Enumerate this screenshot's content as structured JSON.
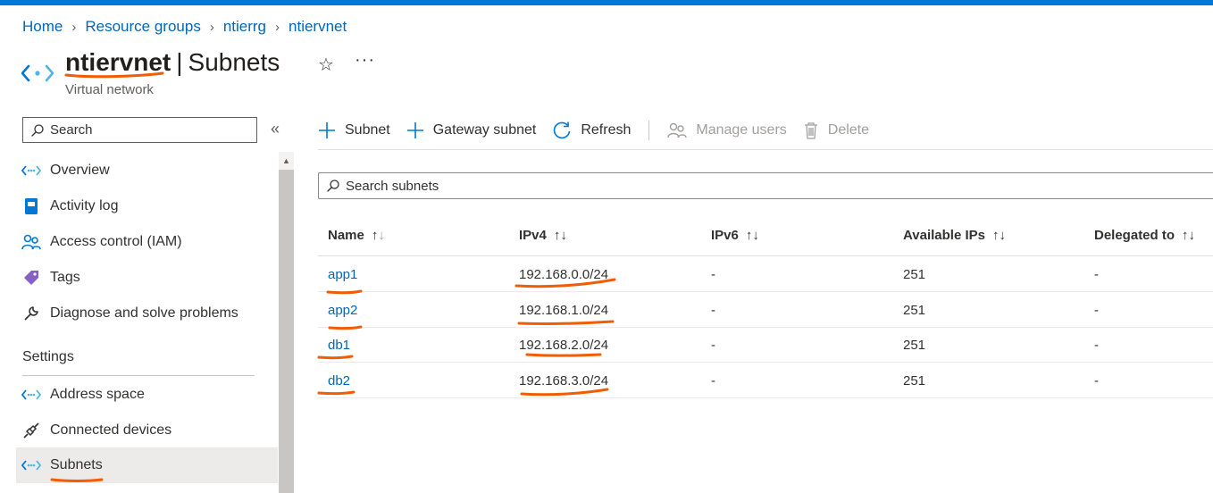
{
  "breadcrumb": [
    "Home",
    "Resource groups",
    "ntierrg",
    "ntiervnet"
  ],
  "header": {
    "resource_name": "ntiervnet",
    "separator": "|",
    "page_name": "Subnets",
    "subtitle": "Virtual network",
    "favorite_icon": "star-icon",
    "more_icon": "ellipsis-icon"
  },
  "sidebar": {
    "search_placeholder": "Search",
    "collapse_glyph": "«",
    "items": [
      {
        "label": "Overview",
        "icon": "vnet-icon"
      },
      {
        "label": "Activity log",
        "icon": "activity-log-icon"
      },
      {
        "label": "Access control (IAM)",
        "icon": "people-icon"
      },
      {
        "label": "Tags",
        "icon": "tag-icon"
      },
      {
        "label": "Diagnose and solve problems",
        "icon": "wrench-icon"
      }
    ],
    "settings_heading": "Settings",
    "settings_items": [
      {
        "label": "Address space",
        "icon": "vnet-icon"
      },
      {
        "label": "Connected devices",
        "icon": "plug-icon"
      },
      {
        "label": "Subnets",
        "icon": "vnet-icon",
        "active": true
      }
    ]
  },
  "toolbar": {
    "add_subnet": "Subnet",
    "gateway_subnet": "Gateway subnet",
    "refresh": "Refresh",
    "manage_users": "Manage users",
    "delete": "Delete"
  },
  "search": {
    "placeholder": "Search subnets"
  },
  "table": {
    "columns": [
      "Name",
      "IPv4",
      "IPv6",
      "Available IPs",
      "Delegated to"
    ],
    "rows": [
      {
        "name": "app1",
        "ipv4": "192.168.0.0/24",
        "ipv6": "-",
        "available": "251",
        "delegated": "-"
      },
      {
        "name": "app2",
        "ipv4": "192.168.1.0/24",
        "ipv6": "-",
        "available": "251",
        "delegated": "-"
      },
      {
        "name": "db1",
        "ipv4": "192.168.2.0/24",
        "ipv6": "-",
        "available": "251",
        "delegated": "-"
      },
      {
        "name": "db2",
        "ipv4": "192.168.3.0/24",
        "ipv6": "-",
        "available": "251",
        "delegated": "-"
      }
    ]
  },
  "colors": {
    "accent": "#0078d4",
    "link": "#0067b8",
    "annotation": "#f25c05"
  }
}
